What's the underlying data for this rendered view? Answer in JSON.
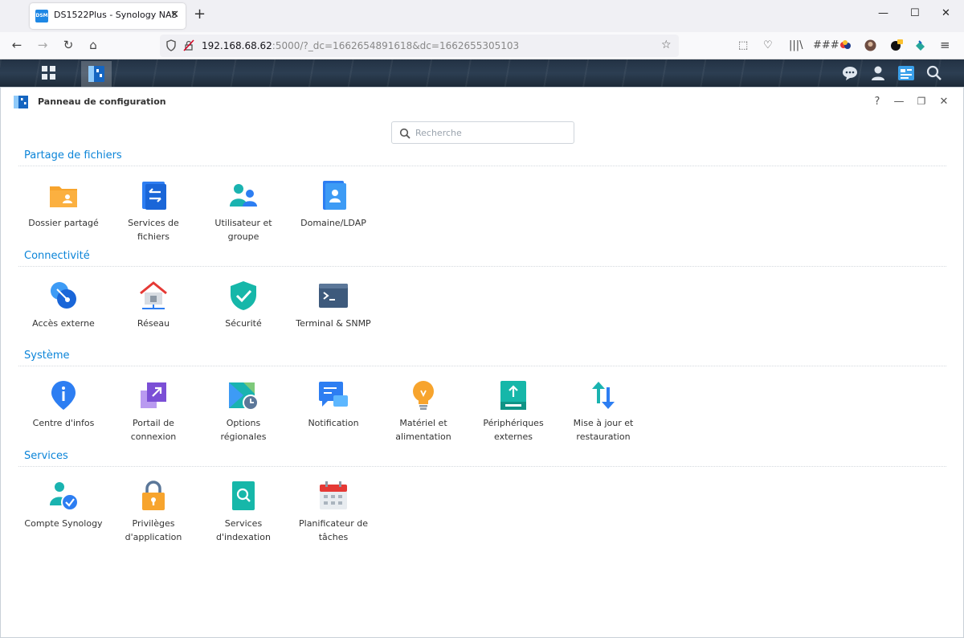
{
  "browser": {
    "tab_title": "DS1522Plus - Synology NAS",
    "tab_favicon_text": "DSM",
    "url_host": "192.168.68.62",
    "url_rest": ":5000/?_dc=1662654891618&dc=1662655305103"
  },
  "window": {
    "title": "Panneau de configuration",
    "help": "?"
  },
  "search": {
    "placeholder": "Recherche"
  },
  "sections": [
    {
      "title": "Partage de fichiers",
      "items": [
        {
          "label": "Dossier partagé"
        },
        {
          "label": "Services de\nfichiers"
        },
        {
          "label": "Utilisateur et\ngroupe"
        },
        {
          "label": "Domaine/LDAP"
        }
      ]
    },
    {
      "title": "Connectivité",
      "items": [
        {
          "label": "Accès externe"
        },
        {
          "label": "Réseau"
        },
        {
          "label": "Sécurité"
        },
        {
          "label": "Terminal & SNMP"
        }
      ]
    },
    {
      "title": "Système",
      "items": [
        {
          "label": "Centre d'infos"
        },
        {
          "label": "Portail de\nconnexion"
        },
        {
          "label": "Options\nrégionales"
        },
        {
          "label": "Notification"
        },
        {
          "label": "Matériel et\nalimentation"
        },
        {
          "label": "Périphériques\nexternes"
        },
        {
          "label": "Mise à jour et\nrestauration"
        }
      ]
    },
    {
      "title": "Services",
      "items": [
        {
          "label": "Compte Synology"
        },
        {
          "label": "Privilèges\nd'application"
        },
        {
          "label": "Services\nd'indexation"
        },
        {
          "label": "Planificateur de\ntâches"
        }
      ]
    }
  ],
  "colors": {
    "section_title": "#0b84d8",
    "dsm_bar": "#233244"
  }
}
